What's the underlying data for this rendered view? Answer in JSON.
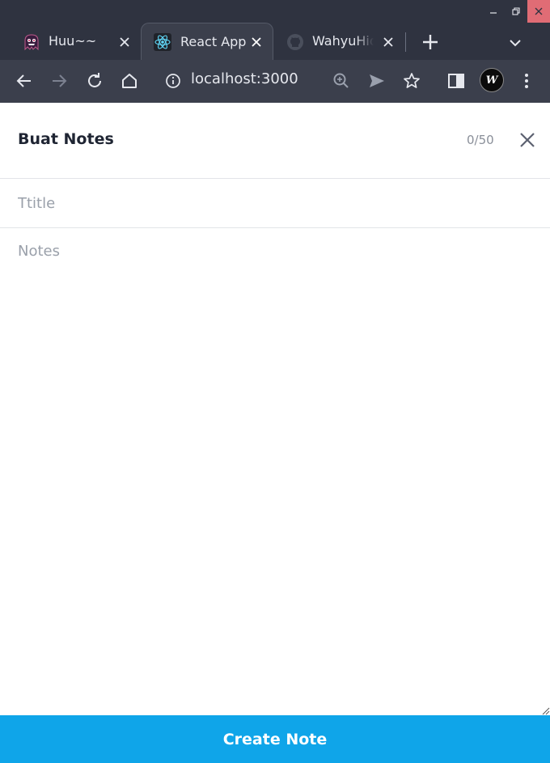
{
  "browser": {
    "window_controls": [
      "minimize",
      "restore",
      "close"
    ],
    "tabs": [
      {
        "label": "Huu~~",
        "icon": "ghost-icon",
        "active": false
      },
      {
        "label": "React App",
        "icon": "react-icon",
        "active": true
      },
      {
        "label": "WahyuHid",
        "icon": "github-icon",
        "active": false
      }
    ],
    "address_bar": {
      "url": "localhost:3000"
    },
    "profile_initials": "W"
  },
  "modal": {
    "title": "Buat Notes",
    "char_count": "0/50",
    "title_field": {
      "value": "",
      "placeholder": "Ttitle"
    },
    "notes_field": {
      "value": "",
      "placeholder": "Notes"
    },
    "submit_label": "Create Note"
  },
  "colors": {
    "chrome_dark": "#2f3340",
    "chrome_toolbar": "#3b3f4c",
    "accent": "#0fa5e9",
    "close_red": "#e06c75",
    "title_text": "#1f2533",
    "placeholder_text": "#9aa0aa"
  }
}
